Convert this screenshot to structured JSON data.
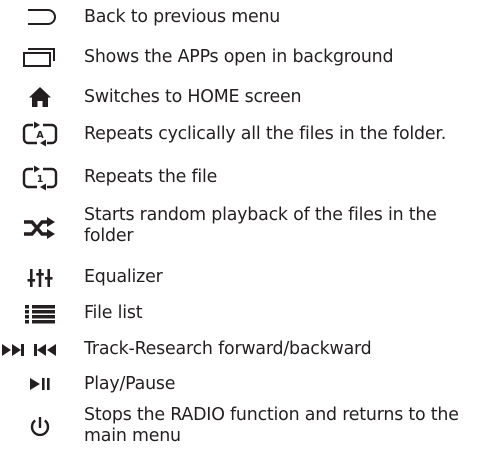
{
  "legend": {
    "items": [
      {
        "icon": "back-arrow-icon",
        "text": "Back to previous menu"
      },
      {
        "icon": "recent-apps-icon",
        "text": "Shows the APPs open in background"
      },
      {
        "icon": "home-icon",
        "text": "Switches to HOME screen"
      },
      {
        "icon": "repeat-all-icon",
        "text": "Repeats cyclically all the files in the folder."
      },
      {
        "icon": "repeat-one-icon",
        "text": "Repeats the file"
      },
      {
        "icon": "shuffle-icon",
        "text": "Starts random playback of the files in the folder"
      },
      {
        "icon": "equalizer-icon",
        "text": "Equalizer"
      },
      {
        "icon": "file-list-icon",
        "text": "File list"
      },
      {
        "icon": "track-seek-icon",
        "text": "Track-Research forward/backward"
      },
      {
        "icon": "play-pause-icon",
        "text": "Play/Pause"
      },
      {
        "icon": "power-icon",
        "text": "Stops the RADIO function and returns to the main menu"
      }
    ],
    "icon_glyphs": {
      "repeat_all_letter": "A",
      "repeat_one_digit": "1"
    }
  }
}
